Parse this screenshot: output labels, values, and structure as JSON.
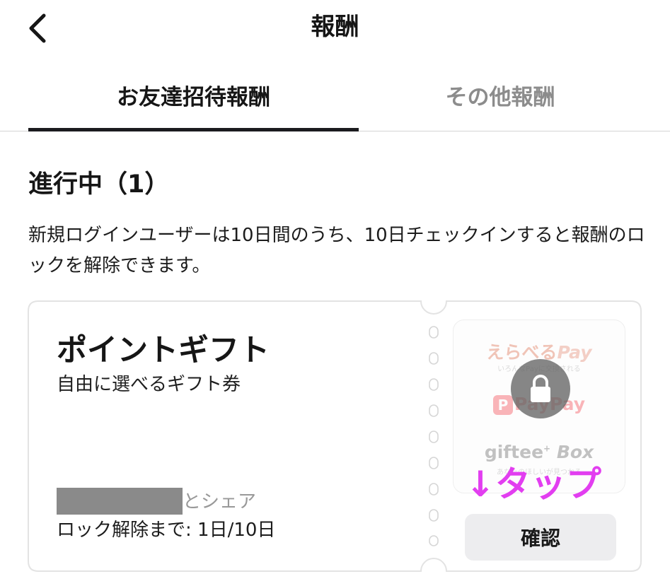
{
  "header": {
    "title": "報酬",
    "back_icon": "chevron-left-icon"
  },
  "tabs": [
    {
      "label": "お友達招待報酬",
      "active": true
    },
    {
      "label": "その他報酬",
      "active": false
    }
  ],
  "section": {
    "title": "進行中（1）",
    "description": "新規ログインユーザーは10日間のうち、10日チェックインすると報酬のロックを解除できます。"
  },
  "ticket": {
    "name": "ポイントギフト",
    "subtitle": "自由に選べるギフト券",
    "share_suffix": "とシェア",
    "unlock_progress": "ロック解除まで: 1日/10日",
    "confirm_label": "確認",
    "reward_image": {
      "brand_1": "えらべる",
      "brand_1_pay": "Pay",
      "brand_1_sub": "いろんなPayに交換される",
      "brand_2_icon": "P",
      "brand_2": "PayPay",
      "brand_3": "giftee",
      "brand_3_box": "Box",
      "brand_3_sub": "あなたのほしいが見つかる",
      "lock_icon": "lock-icon"
    }
  },
  "annotation": {
    "tap_label": "↓タップ",
    "color": "#e23ef0"
  },
  "colors": {
    "tab_underline": "#1b1b1f",
    "inactive_tab": "#8c8c8c",
    "button_bg": "#ededef"
  }
}
